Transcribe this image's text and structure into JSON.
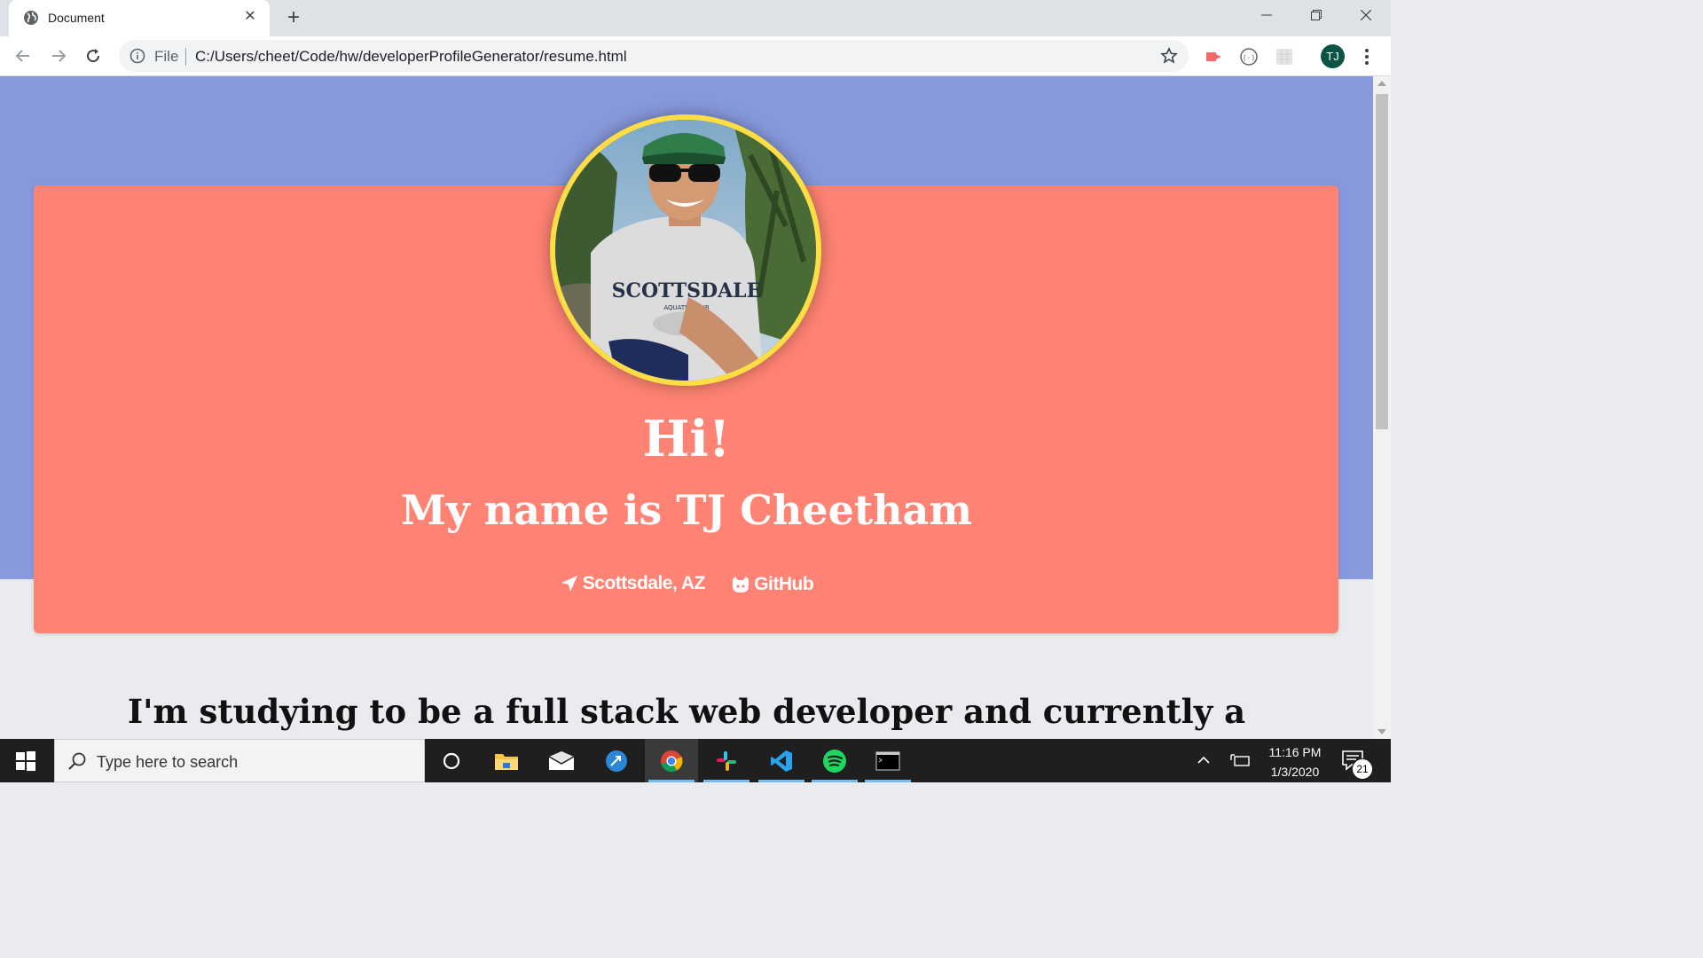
{
  "browser": {
    "tab_title": "Document",
    "url_scheme": "File",
    "url": "C:/Users/cheet/Code/hw/developerProfileGenerator/resume.html",
    "profile_initials": "TJ"
  },
  "page": {
    "greeting": "Hi!",
    "name_line": "My name is TJ Cheetham",
    "location_link": "Scottsdale, AZ",
    "github_link": "GitHub",
    "bio_text": "I'm studying to be a full stack web developer and currently a",
    "colors": {
      "hero_background": "#8799dc",
      "card_background": "#ff8374",
      "avatar_border": "#fede44"
    }
  },
  "taskbar": {
    "search_placeholder": "Type here to search",
    "time": "11:16 PM",
    "date": "1/3/2020",
    "notification_count": "21",
    "pinned_apps": [
      "cortana-icon",
      "file-explorer-icon",
      "mail-icon",
      "remote-app-icon",
      "chrome-icon",
      "slack-icon",
      "vscode-icon",
      "spotify-icon",
      "terminal-icon"
    ]
  }
}
